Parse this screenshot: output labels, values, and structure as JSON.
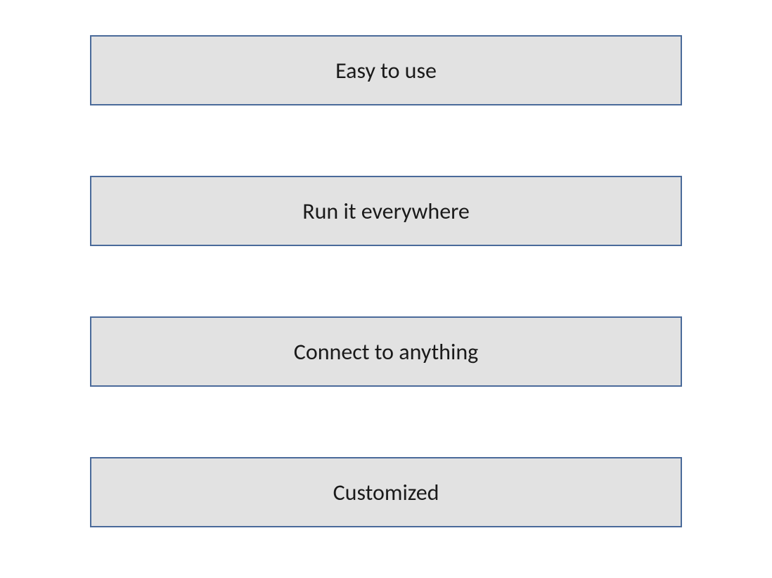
{
  "boxes": [
    {
      "label": "Easy to use"
    },
    {
      "label": "Run it everywhere"
    },
    {
      "label": "Connect to anything"
    },
    {
      "label": "Customized"
    }
  ],
  "colors": {
    "box_fill": "#e2e2e2",
    "box_border": "#4a6a9a",
    "text": "#1a1a1a"
  }
}
